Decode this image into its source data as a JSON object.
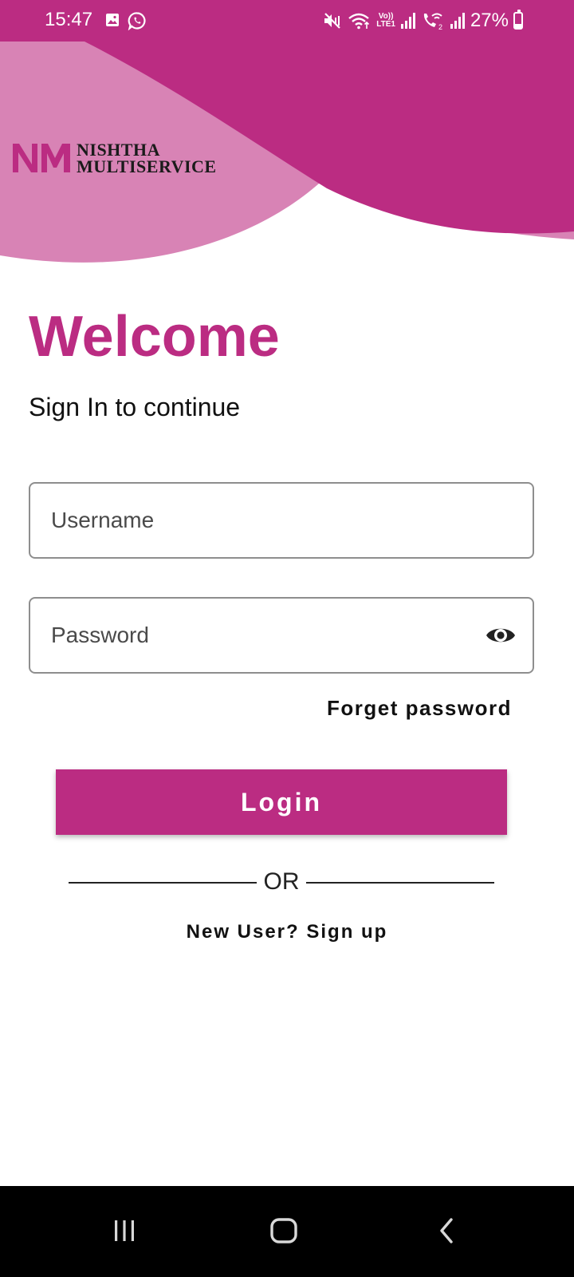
{
  "status_bar": {
    "time": "15:47",
    "battery_text": "27%",
    "battery_level": 0.27,
    "network_label_top": "Vo))",
    "network_label_bottom": "LTE1",
    "icons": [
      "gallery-icon",
      "whatsapp-icon",
      "mute-vibrate-icon",
      "wifi-icon",
      "signal-sim1-icon",
      "wifi-calling-icon",
      "signal-sim2-icon",
      "battery-icon"
    ]
  },
  "header": {
    "logo_line1": "NISHTHA",
    "logo_line2": "MULTISERVICE",
    "logo_mark": "NM"
  },
  "main": {
    "title": "Welcome",
    "subtitle": "Sign In to continue"
  },
  "form": {
    "username_placeholder": "Username",
    "username_value": "",
    "password_placeholder": "Password",
    "password_value": "",
    "forgot_label": "Forget password",
    "login_label": "Login",
    "or_label": "OR",
    "signup_label": "New User? Sign up"
  },
  "nav_bar": {
    "icons": [
      "recent-apps-icon",
      "home-icon",
      "back-icon"
    ]
  },
  "colors": {
    "brand": "#bb2c82",
    "brand_light": "#d883b5",
    "text": "#111111",
    "field_border": "#8e8e8e"
  }
}
